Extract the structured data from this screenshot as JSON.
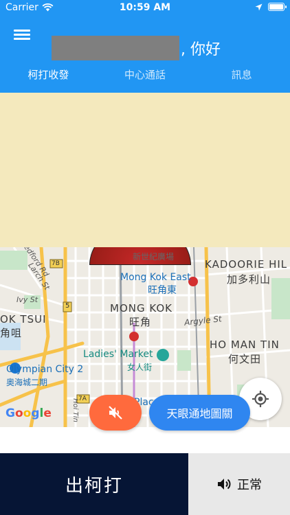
{
  "status_bar": {
    "carrier": "Carrier",
    "time": "10:59 AM",
    "wifi_icon": "wifi-icon",
    "location_icon": "location-arrow-icon",
    "battery_icon": "battery-full-icon"
  },
  "header": {
    "greeting_suffix": ", 你好",
    "menu_icon": "hamburger-menu-icon",
    "bg_color": "#2196f3"
  },
  "tabs": [
    {
      "label": "柯打收發"
    },
    {
      "label": "中心通話"
    },
    {
      "label": "訊息"
    }
  ],
  "map": {
    "labels": {
      "kadoorie_en": "KADOORIE HIL",
      "kadoorie_zh": "加多利山",
      "mongkok_station_zh": "新世紀廣場",
      "mongkok_east_en": "Mong Kok East",
      "mongkok_east_zh": "旺角東",
      "mongkok_en": "MONG KOK",
      "mongkok_zh": "旺角",
      "argyle": "Argyle St",
      "tsui_en": "OK TSUI",
      "tsui_zh": "角咀",
      "homantin_en": "HO MAN TIN",
      "homantin_zh": "何文田",
      "ladies_en": "Ladies' Market",
      "ladies_zh": "女人街",
      "olympian_en": "Olympian City 2",
      "olympian_zh": "奧海城二期",
      "bedford": "Bedford Rd",
      "larch": "Larch St",
      "ivy": "Ivy St",
      "route_5": "5",
      "route_7b": "7B",
      "route_7a": "7A",
      "hoi_ting": "Hoi Tin",
      "place": "Plac",
      "google": "Google"
    },
    "locate_icon": "my-location-icon"
  },
  "buttons": {
    "mute_icon": "volume-off-icon",
    "sky_eye": "天眼通地圖關",
    "send_order": "出柯打",
    "mode_label": "正常",
    "mode_icon": "volume-up-icon"
  },
  "colors": {
    "upper_panel": "#f4e9bd",
    "mute": "#ff6a3d",
    "sky": "#2f86f0",
    "send": "#061535",
    "mode": "#e8e8e8"
  }
}
